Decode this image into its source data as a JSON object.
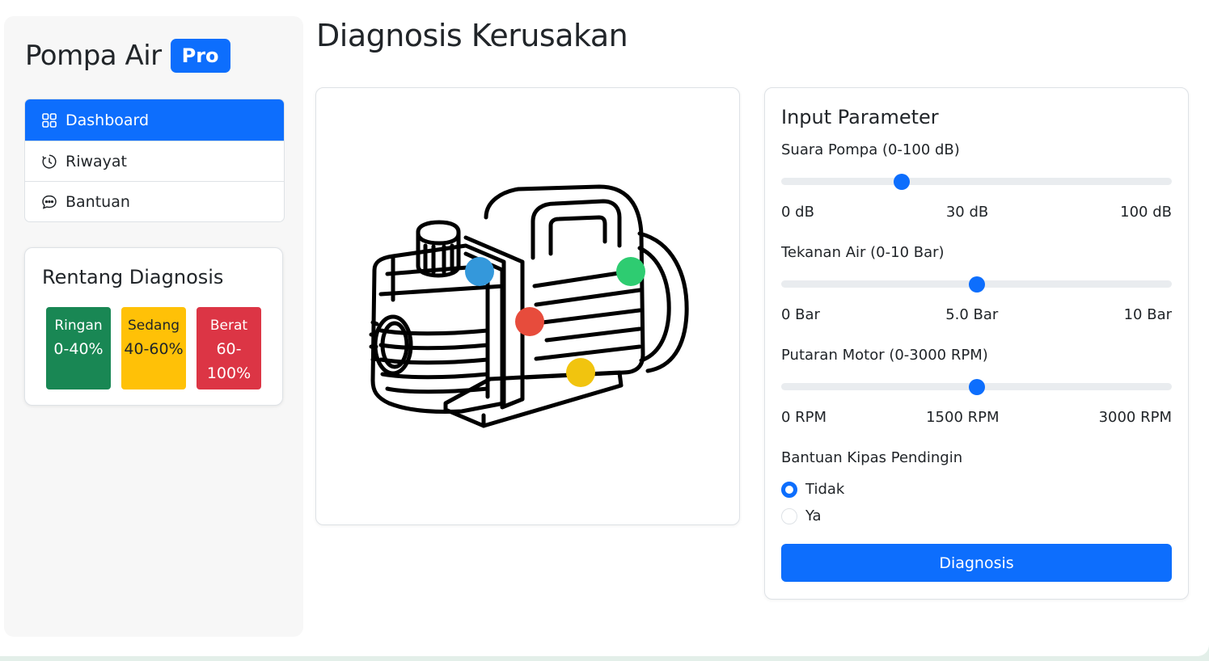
{
  "brand": {
    "title": "Pompa Air",
    "badge": "Pro"
  },
  "nav": {
    "items": [
      {
        "label": "Dashboard",
        "icon": "grid-icon",
        "active": true
      },
      {
        "label": "Riwayat",
        "icon": "clock-icon",
        "active": false
      },
      {
        "label": "Bantuan",
        "icon": "chat-icon",
        "active": false
      }
    ]
  },
  "range": {
    "title": "Rentang Diagnosis",
    "levels": [
      {
        "name": "Ringan",
        "value": "0-40%",
        "color": "#198754"
      },
      {
        "name": "Sedang",
        "value": "40-60%",
        "color": "#ffc107"
      },
      {
        "name": "Berat",
        "value_line1": "60-",
        "value_line2": "100%",
        "color": "#dc3545"
      }
    ]
  },
  "page": {
    "title": "Diagnosis Kerusakan"
  },
  "pump_image": {
    "icon": "water-pump-illustration",
    "markers": [
      {
        "name": "blue-marker",
        "color": "#3498db"
      },
      {
        "name": "green-marker",
        "color": "#2ecc71"
      },
      {
        "name": "red-marker",
        "color": "#e74c3c"
      },
      {
        "name": "yellow-marker",
        "color": "#f1c40f"
      }
    ]
  },
  "params": {
    "title": "Input Parameter",
    "noise": {
      "label": "Suara Pompa (0-100 dB)",
      "min_label": "0 dB",
      "value_label": "30 dB",
      "max_label": "100 dB",
      "value": 30,
      "min": 0,
      "max": 100
    },
    "pressure": {
      "label": "Tekanan Air (0-10 Bar)",
      "min_label": "0 Bar",
      "value_label": "5.0 Bar",
      "max_label": "10 Bar",
      "value": 5.0,
      "min": 0,
      "max": 10
    },
    "rotation": {
      "label": "Putaran Motor (0-3000 RPM)",
      "min_label": "0 RPM",
      "value_label": "1500 RPM",
      "max_label": "3000 RPM",
      "value": 1500,
      "min": 0,
      "max": 3000
    },
    "fan": {
      "label": "Bantuan Kipas Pendingin",
      "options": [
        "Tidak",
        "Ya"
      ],
      "selected": "Tidak"
    },
    "button_label": "Diagnosis"
  },
  "colors": {
    "accent": "#0d6efd"
  }
}
